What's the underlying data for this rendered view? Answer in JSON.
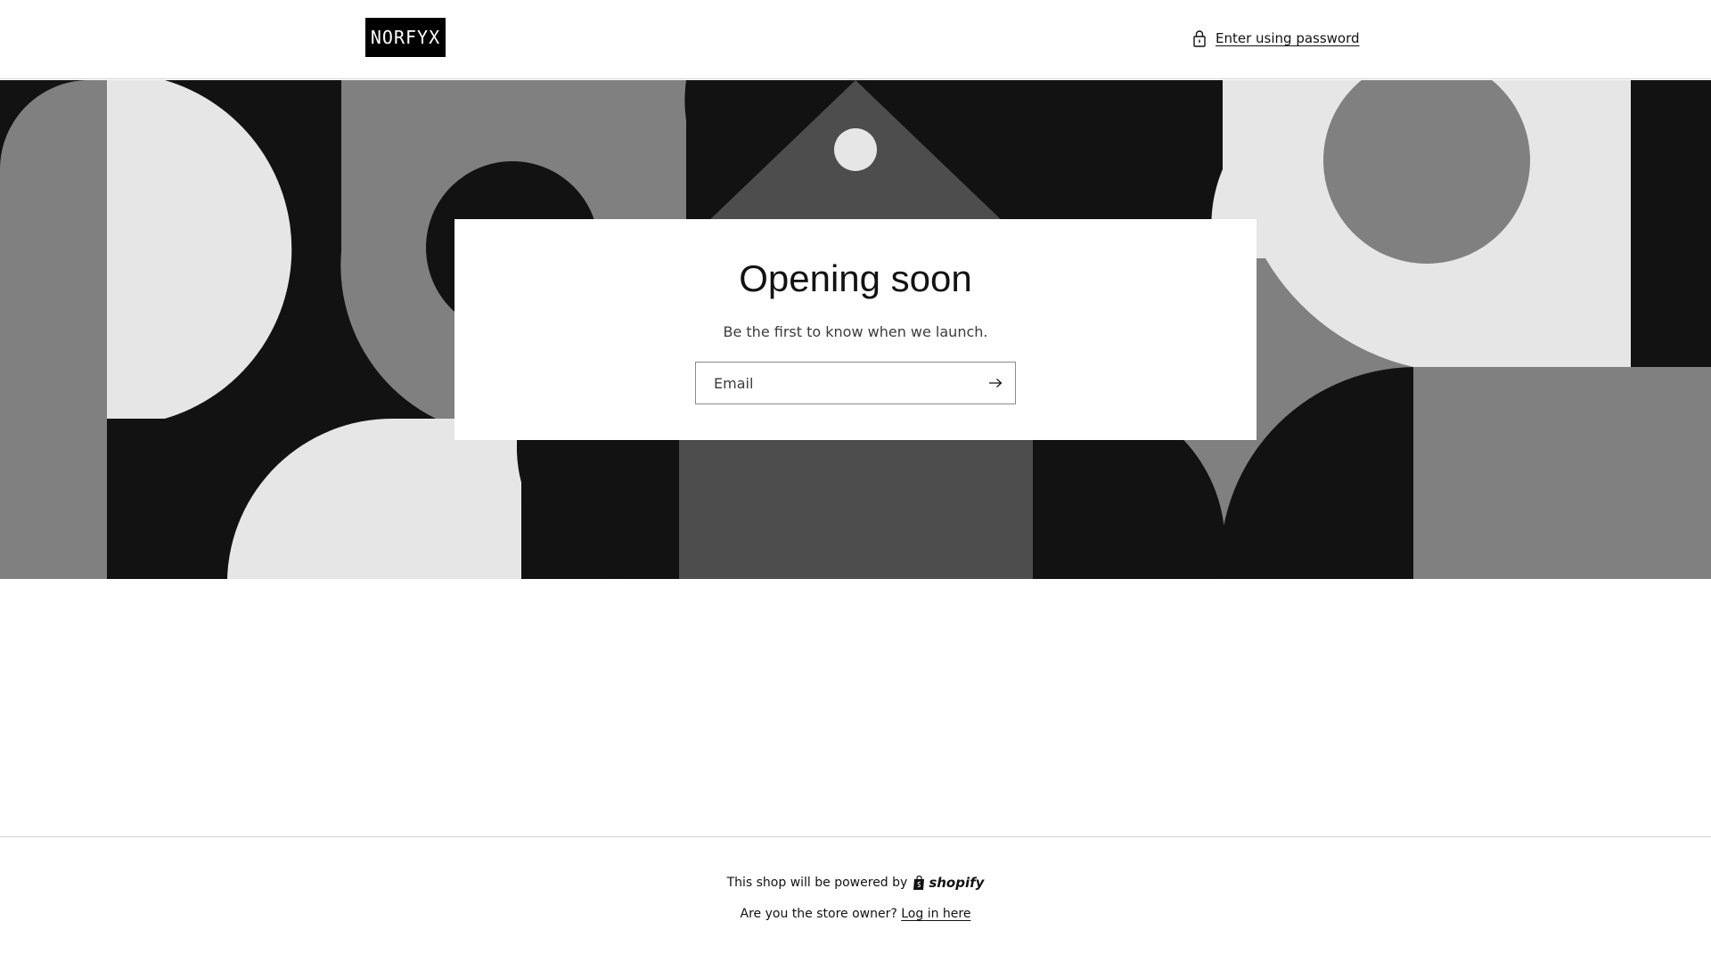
{
  "header": {
    "logo_text": "NORFYX",
    "password_link_label": "Enter using password",
    "lock_icon": "lock-icon"
  },
  "card": {
    "title": "Opening soon",
    "subtitle": "Be the first to know when we launch.",
    "email_placeholder": "Email",
    "submit_icon": "arrow-right-icon"
  },
  "footer": {
    "powered_text": "This shop will be powered by",
    "shopify_label": "shopify",
    "owner_question": "Are you the store owner?",
    "login_label": "Log in here"
  },
  "colors": {
    "dark": "#121212",
    "mid_gray": "#808080",
    "dark_gray": "#4d4d4d",
    "light_gray": "#e6e6e6",
    "white": "#ffffff"
  }
}
